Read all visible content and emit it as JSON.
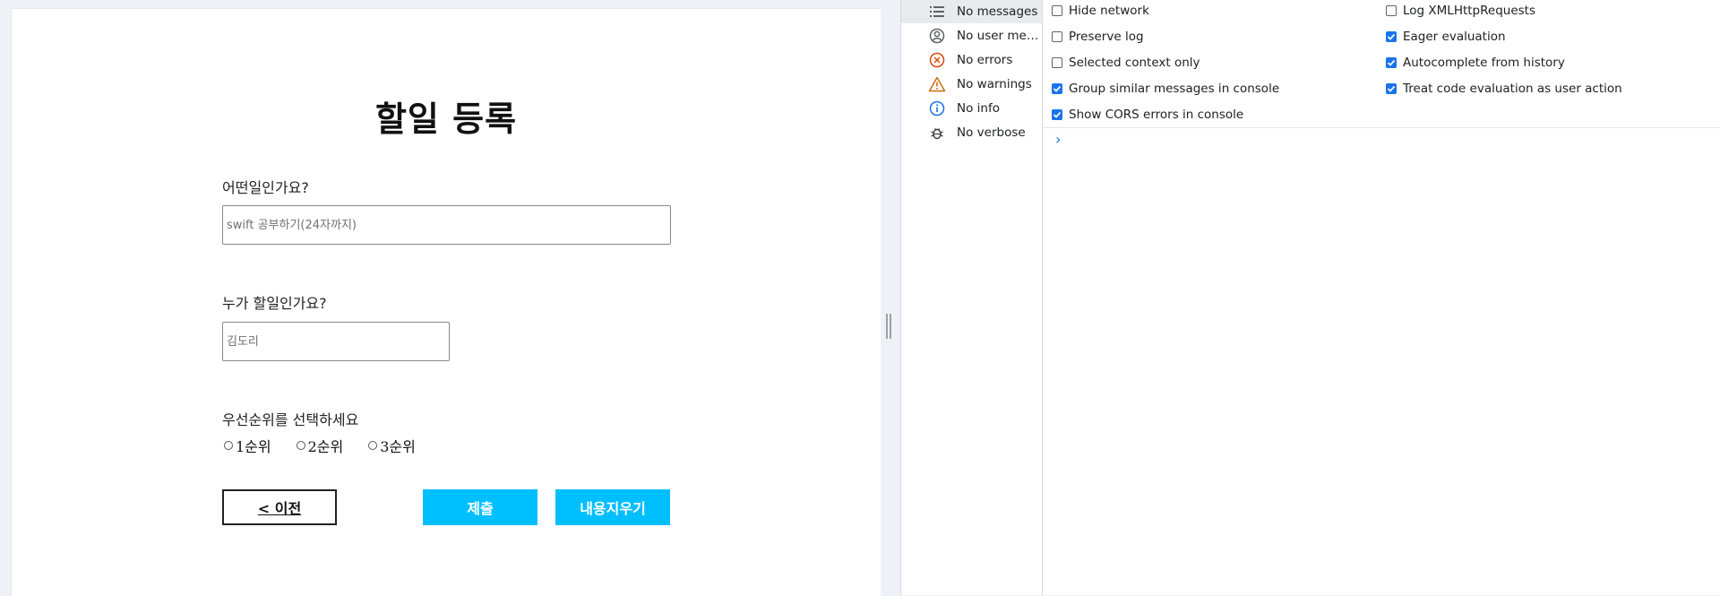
{
  "form": {
    "title": "할일 등록",
    "task_label": "어떤일인가요?",
    "task_placeholder": "swift 공부하기(24자까지)",
    "assignee_label": "누가 할일인가요?",
    "assignee_placeholder": "김도리",
    "priority_label": "우선순위를 선택하세요",
    "priorities": [
      "1순위",
      "2순위",
      "3순위"
    ],
    "prev_button": "< 이전",
    "submit_button": "제출",
    "clear_button": "내용지우기",
    "button_color": "#00bfff"
  },
  "devtools": {
    "sidebar": [
      {
        "label": "No messages",
        "icon": "list-icon"
      },
      {
        "label": "No user mes...",
        "icon": "user-icon"
      },
      {
        "label": "No errors",
        "icon": "error-icon"
      },
      {
        "label": "No warnings",
        "icon": "warning-icon"
      },
      {
        "label": "No info",
        "icon": "info-icon"
      },
      {
        "label": "No verbose",
        "icon": "bug-icon"
      }
    ],
    "settings_left": [
      {
        "label": "Hide network",
        "checked": false
      },
      {
        "label": "Preserve log",
        "checked": false
      },
      {
        "label": "Selected context only",
        "checked": false
      },
      {
        "label": "Group similar messages in console",
        "checked": true
      },
      {
        "label": "Show CORS errors in console",
        "checked": true
      }
    ],
    "settings_right": [
      {
        "label": "Log XMLHttpRequests",
        "checked": false
      },
      {
        "label": "Eager evaluation",
        "checked": true
      },
      {
        "label": "Autocomplete from history",
        "checked": true
      },
      {
        "label": "Treat code evaluation as user action",
        "checked": true
      }
    ],
    "prompt_symbol": "›",
    "accent_color": "#1a73e8"
  }
}
